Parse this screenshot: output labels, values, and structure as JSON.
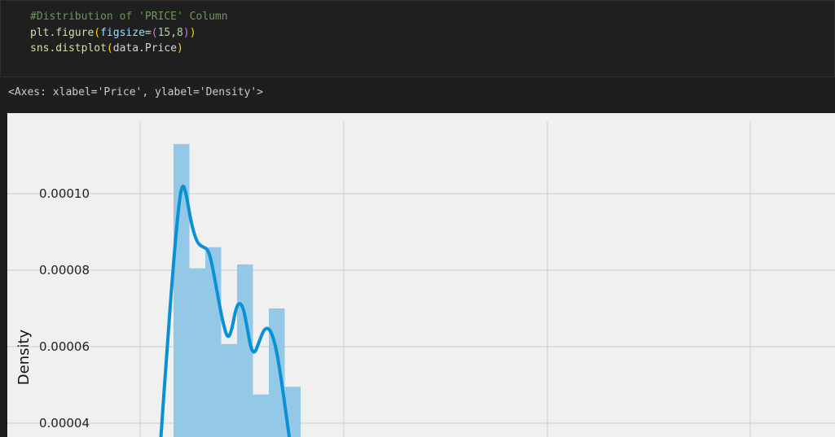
{
  "cell": {
    "line1": "#Distribution of 'PRICE' Column",
    "line2": {
      "fn": "plt.figure",
      "param": "figsize",
      "eq": "=",
      "open_paren": "(",
      "open_inner": "(",
      "val1": "15",
      "comma": ",",
      "val2": "8",
      "close_inner": ")",
      "close_paren": ")"
    },
    "line3": {
      "fn": "sns.distplot",
      "open_paren": "(",
      "arg": "data.Price",
      "close_paren": ")"
    }
  },
  "output": {
    "repr": "<Axes: xlabel='Price', ylabel='Density'>"
  },
  "chart_data": {
    "type": "bar",
    "ylabel": "Density",
    "yticks": [
      {
        "value": 0.0001,
        "label": "0.00010"
      },
      {
        "value": 8e-05,
        "label": "0.00008"
      },
      {
        "value": 6e-05,
        "label": "0.00006"
      },
      {
        "value": 4e-05,
        "label": "0.00004"
      }
    ],
    "ylim_visible": [
      3.59e-05,
      0.000118
    ],
    "bins": [
      {
        "index": 0,
        "density": 0.000113
      },
      {
        "index": 1,
        "density": 8.05e-05
      },
      {
        "index": 2,
        "density": 8.6e-05
      },
      {
        "index": 3,
        "density": 6.07e-05
      },
      {
        "index": 4,
        "density": 8.15e-05
      },
      {
        "index": 5,
        "density": 4.75e-05
      },
      {
        "index": 6,
        "density": 7e-05
      },
      {
        "index": 7,
        "density": 4.95e-05
      }
    ],
    "kde": [
      [
        -0.8,
        3.59e-05
      ],
      [
        -0.4,
        6e-05
      ],
      [
        0.0,
        8.2e-05
      ],
      [
        0.3,
        9.6e-05
      ],
      [
        0.55,
        0.000103
      ],
      [
        0.8,
        0.0001
      ],
      [
        1.1,
        9.25e-05
      ],
      [
        1.45,
        8.75e-05
      ],
      [
        1.75,
        8.62e-05
      ],
      [
        2.2,
        8.55e-05
      ],
      [
        2.5,
        8e-05
      ],
      [
        2.8,
        7.3e-05
      ],
      [
        3.1,
        6.65e-05
      ],
      [
        3.4,
        6.2e-05
      ],
      [
        3.65,
        6.4e-05
      ],
      [
        3.9,
        6.95e-05
      ],
      [
        4.1,
        7.15e-05
      ],
      [
        4.35,
        7.08e-05
      ],
      [
        4.6,
        6.6e-05
      ],
      [
        4.85,
        5.98e-05
      ],
      [
        5.1,
        5.8e-05
      ],
      [
        5.4,
        6.15e-05
      ],
      [
        5.75,
        6.5e-05
      ],
      [
        6.1,
        6.45e-05
      ],
      [
        6.45,
        6e-05
      ],
      [
        6.8,
        5.1e-05
      ],
      [
        7.1,
        4.2e-05
      ],
      [
        7.3,
        3.59e-05
      ]
    ],
    "grid": true,
    "bar_color": "#93c8e7",
    "line_color": "#0a90d4",
    "background": "#f0f0f0"
  }
}
